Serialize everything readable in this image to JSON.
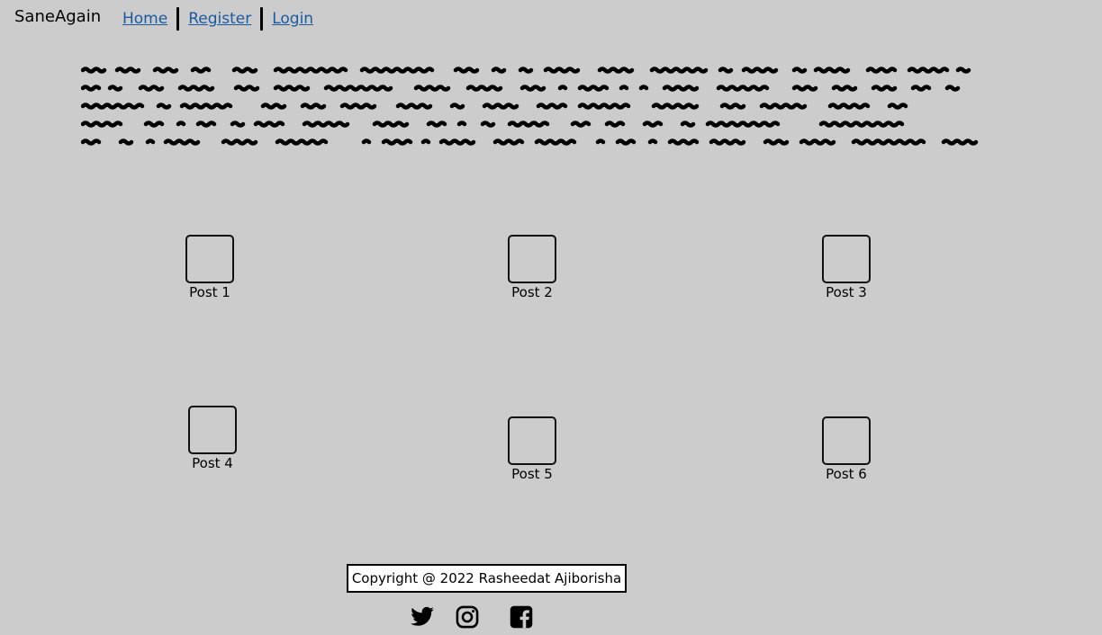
{
  "header": {
    "brand": "SaneAgain",
    "nav": [
      {
        "label": "Home"
      },
      {
        "label": "Register"
      },
      {
        "label": "Login"
      }
    ]
  },
  "posts": [
    {
      "label": "Post 1"
    },
    {
      "label": "Post 2"
    },
    {
      "label": "Post 3"
    },
    {
      "label": "Post 4"
    },
    {
      "label": "Post 5"
    },
    {
      "label": "Post 6"
    }
  ],
  "footer": {
    "copyright": "Copyright @ 2022 Rasheedat Ajiborisha",
    "social": [
      {
        "icon": "twitter-icon"
      },
      {
        "icon": "instagram-icon"
      },
      {
        "icon": "facebook-icon"
      }
    ]
  },
  "colors": {
    "background": "#cccccc",
    "link": "#1a5aa0"
  }
}
